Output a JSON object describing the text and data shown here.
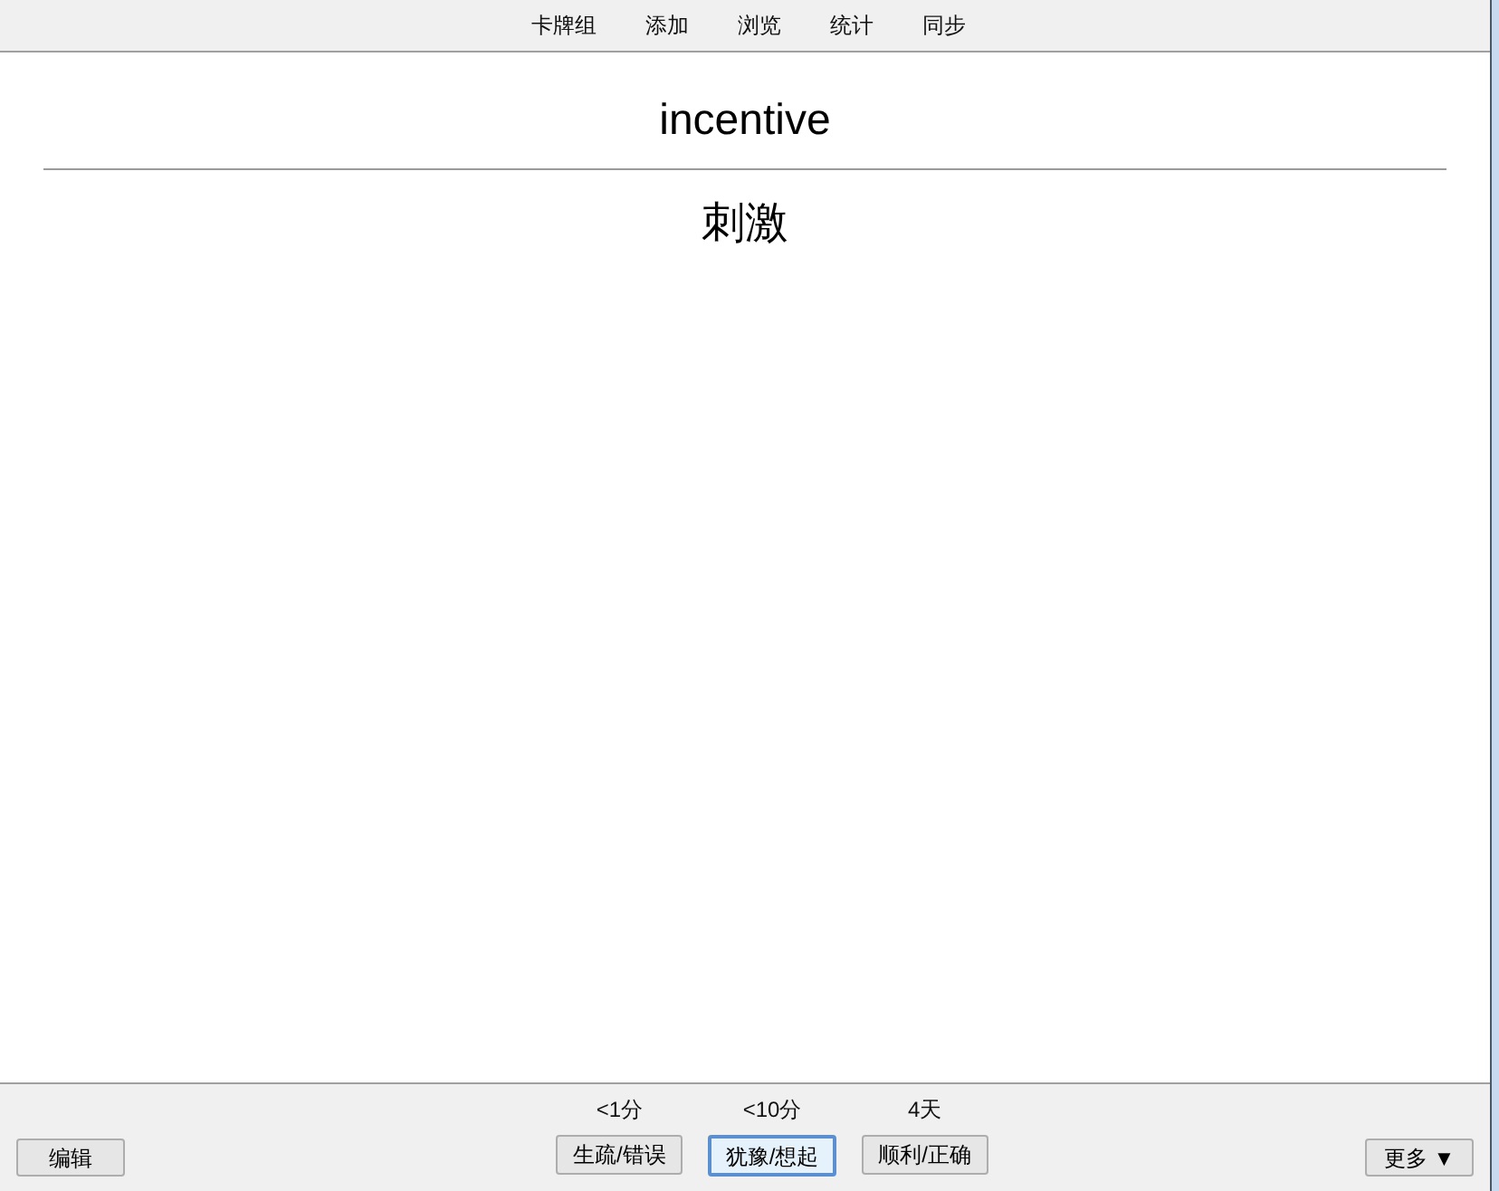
{
  "menu": [
    {
      "label": "卡牌组"
    },
    {
      "label": "添加"
    },
    {
      "label": "浏览"
    },
    {
      "label": "统计"
    },
    {
      "label": "同步"
    }
  ],
  "card": {
    "front": "incentive",
    "back": "刺激"
  },
  "edit_button": {
    "label": "编辑"
  },
  "answers": [
    {
      "interval": "<1分",
      "label": "生疏/错误",
      "selected": false
    },
    {
      "interval": "<10分",
      "label": "犹豫/想起",
      "selected": true
    },
    {
      "interval": "4天",
      "label": "顺利/正确",
      "selected": false
    }
  ],
  "more_button": {
    "label": "更多 ▼"
  }
}
